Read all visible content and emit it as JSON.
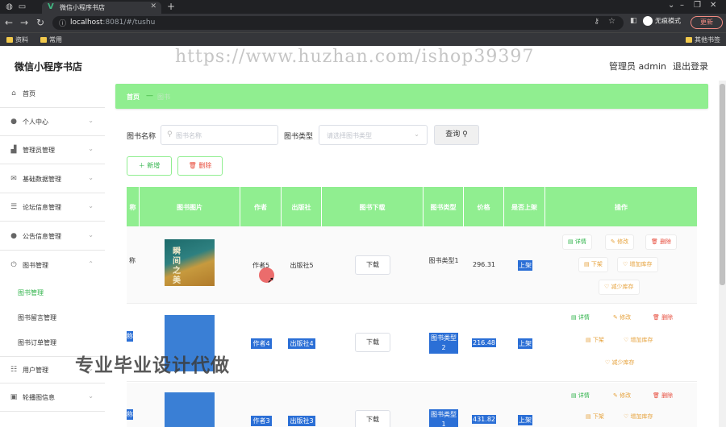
{
  "browser": {
    "tab_title": "微信小程序书店",
    "url_host": "localhost",
    "url_path": ":8081/#/tushu",
    "incognito_label": "无痕模式",
    "update_label": "更新",
    "bookmarks": [
      "资料",
      "常用"
    ],
    "bookmarks_right": "其他书签"
  },
  "header": {
    "title": "微信小程序书店",
    "user_label": "管理员 admin",
    "logout_label": "退出登录"
  },
  "watermarks": {
    "url": "https://www.huzhan.com/ishop39397",
    "text": "专业毕业设计代做"
  },
  "sidebar": {
    "items": [
      {
        "label": "首页",
        "icon": "home-icon"
      },
      {
        "label": "个人中心",
        "icon": "user-icon"
      },
      {
        "label": "管理员管理",
        "icon": "chart-icon"
      },
      {
        "label": "基础数据管理",
        "icon": "mail-icon"
      },
      {
        "label": "论坛信息管理",
        "icon": "list-icon"
      },
      {
        "label": "公告信息管理",
        "icon": "user-icon"
      },
      {
        "label": "图书管理",
        "icon": "power-icon"
      }
    ],
    "sub_items": [
      {
        "label": "图书管理",
        "active": true
      },
      {
        "label": "图书留言管理",
        "active": false
      },
      {
        "label": "图书订单管理",
        "active": false
      }
    ],
    "items_after": [
      {
        "label": "用户管理",
        "icon": "sliders-icon"
      },
      {
        "label": "轮播图信息",
        "icon": "image-icon"
      }
    ]
  },
  "breadcrumb": {
    "home": "首页",
    "current": "图书"
  },
  "search": {
    "name_label": "图书名称",
    "name_placeholder": "图书名称",
    "type_label": "图书类型",
    "type_placeholder": "请选择图书类型",
    "query_label": "查询"
  },
  "actions": {
    "add_label": "新增",
    "delete_label": "删除"
  },
  "table": {
    "columns": [
      "称",
      "图书图片",
      "作者",
      "出版社",
      "图书下载",
      "图书类型",
      "价格",
      "是否上架",
      "操作"
    ],
    "rows": [
      {
        "name": "称",
        "author": "作者5",
        "publisher": "出版社5",
        "type": "图书类型1",
        "price": "296.31",
        "listed": "上架",
        "selected": false
      },
      {
        "name": "称",
        "author": "作者4",
        "publisher": "出版社4",
        "type": "图书类型2",
        "price": "216.48",
        "listed": "上架",
        "selected": true
      },
      {
        "name": "称",
        "author": "作者3",
        "publisher": "出版社3",
        "type": "图书类型1",
        "price": "431.82",
        "listed": "上架",
        "selected": true
      }
    ],
    "download_label": "下载",
    "ops": {
      "detail": "详情",
      "edit": "修改",
      "remove": "删除",
      "down": "下架",
      "incr": "增加库存",
      "decr": "减少库存"
    },
    "cover1_text": "瞬间之美"
  }
}
